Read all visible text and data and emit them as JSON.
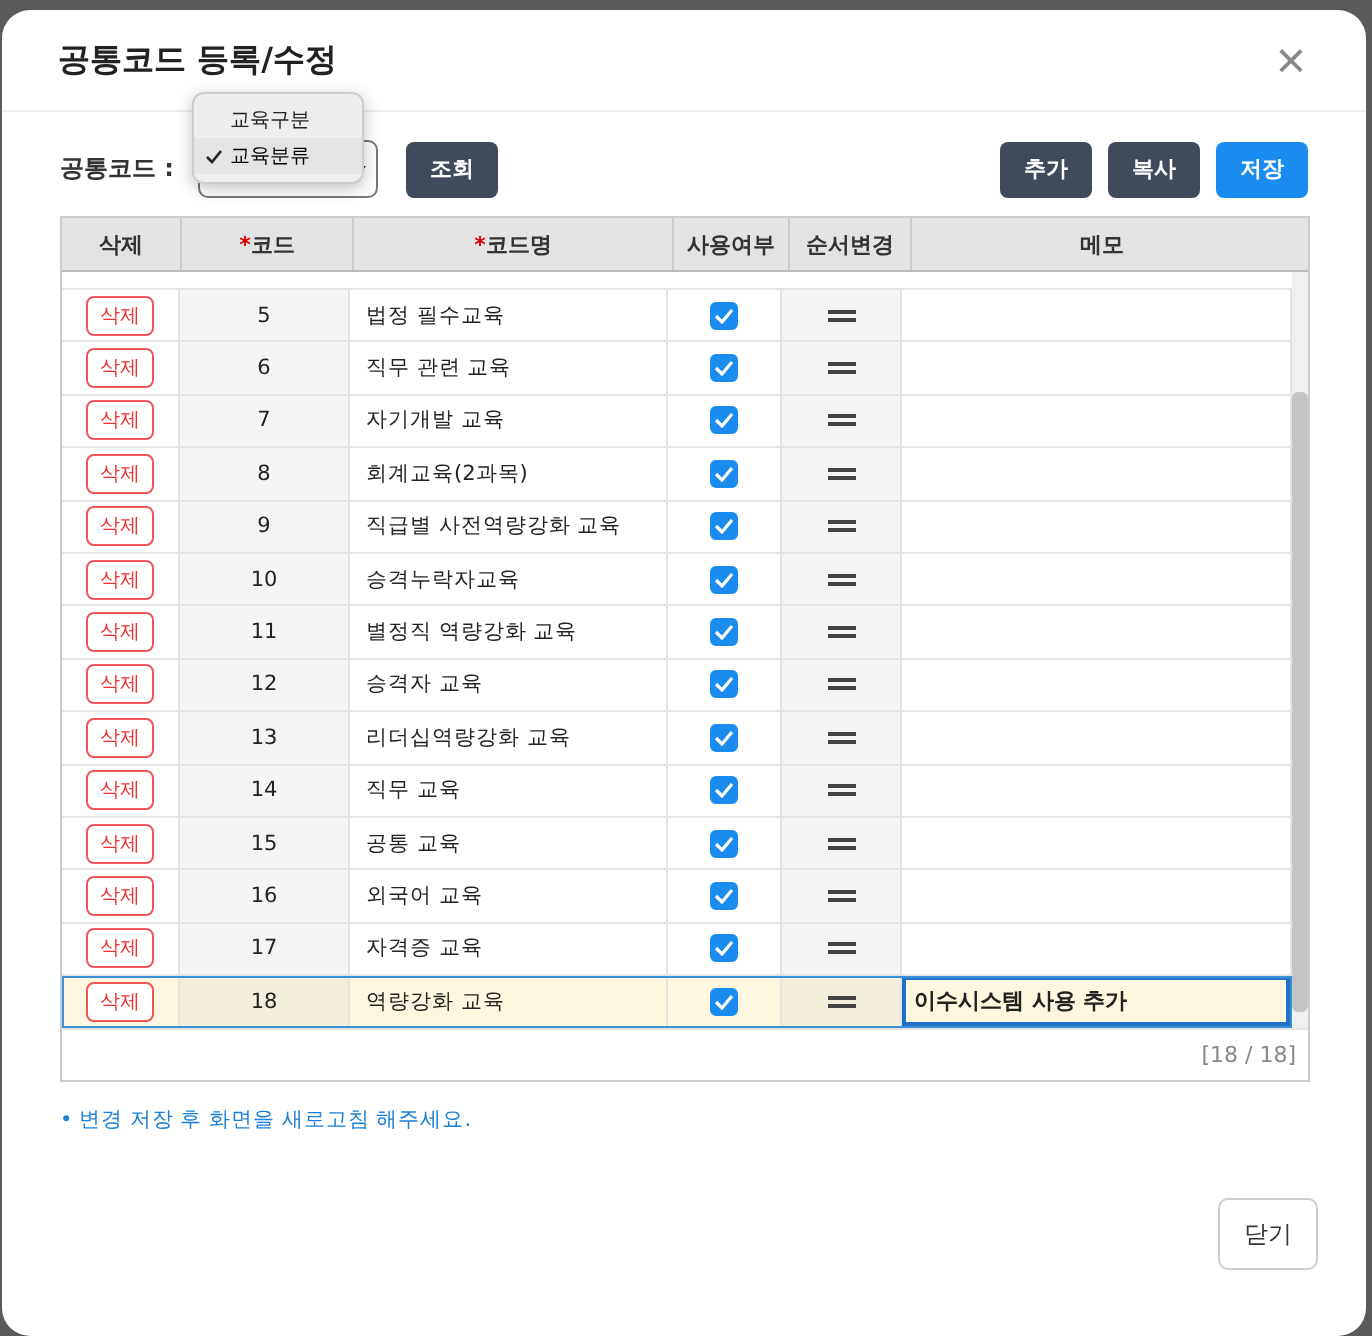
{
  "dialog": {
    "title": "공통코드 등록/수정",
    "close_icon": "×"
  },
  "toolbar": {
    "label": "공통코드 :",
    "select_menu": [
      {
        "label": "교육구분",
        "selected": false
      },
      {
        "label": "교육분류",
        "selected": true
      }
    ],
    "search_button": "조회",
    "buttons": [
      {
        "label": "추가",
        "kind": "dark"
      },
      {
        "label": "복사",
        "kind": "dark"
      },
      {
        "label": "저장",
        "kind": "primary"
      }
    ]
  },
  "table": {
    "columns": [
      {
        "label": "삭제",
        "required": false
      },
      {
        "label": "코드",
        "required": true
      },
      {
        "label": "코드명",
        "required": true
      },
      {
        "label": "사용여부",
        "required": false
      },
      {
        "label": "순서변경",
        "required": false
      },
      {
        "label": "메모",
        "required": false
      }
    ],
    "required_mark": "*",
    "rows": [
      {
        "delete": "삭제",
        "code": "5",
        "name": "법정 필수교육",
        "used": true,
        "memo": "",
        "selected": false
      },
      {
        "delete": "삭제",
        "code": "6",
        "name": "직무 관련 교육",
        "used": true,
        "memo": "",
        "selected": false
      },
      {
        "delete": "삭제",
        "code": "7",
        "name": "자기개발 교육",
        "used": true,
        "memo": "",
        "selected": false
      },
      {
        "delete": "삭제",
        "code": "8",
        "name": "회계교육(2과목)",
        "used": true,
        "memo": "",
        "selected": false
      },
      {
        "delete": "삭제",
        "code": "9",
        "name": "직급별 사전역량강화 교육",
        "used": true,
        "memo": "",
        "selected": false
      },
      {
        "delete": "삭제",
        "code": "10",
        "name": "승격누락자교육",
        "used": true,
        "memo": "",
        "selected": false
      },
      {
        "delete": "삭제",
        "code": "11",
        "name": "별정직 역량강화 교육",
        "used": true,
        "memo": "",
        "selected": false
      },
      {
        "delete": "삭제",
        "code": "12",
        "name": "승격자 교육",
        "used": true,
        "memo": "",
        "selected": false
      },
      {
        "delete": "삭제",
        "code": "13",
        "name": "리더십역량강화 교육",
        "used": true,
        "memo": "",
        "selected": false
      },
      {
        "delete": "삭제",
        "code": "14",
        "name": "직무 교육",
        "used": true,
        "memo": "",
        "selected": false
      },
      {
        "delete": "삭제",
        "code": "15",
        "name": "공통 교육",
        "used": true,
        "memo": "",
        "selected": false
      },
      {
        "delete": "삭제",
        "code": "16",
        "name": "외국어 교육",
        "used": true,
        "memo": "",
        "selected": false
      },
      {
        "delete": "삭제",
        "code": "17",
        "name": "자격증 교육",
        "used": true,
        "memo": "",
        "selected": false
      },
      {
        "delete": "삭제",
        "code": "18",
        "name": "역량강화 교육",
        "used": true,
        "memo": "이수시스템 사용 추가",
        "selected": true
      }
    ],
    "count": "[18 / 18]"
  },
  "note": "• 변경 저장 후 화면을 새로고침 해주세요.",
  "footer": {
    "close_button": "닫기"
  }
}
